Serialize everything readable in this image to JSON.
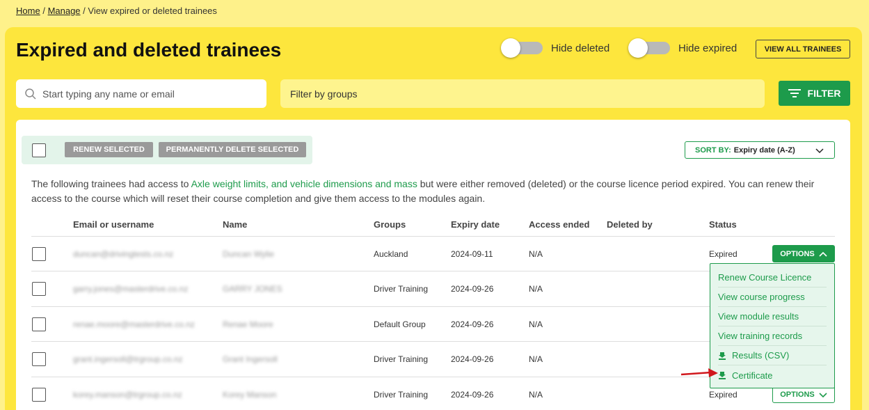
{
  "breadcrumb": {
    "home": "Home",
    "manage": "Manage",
    "sep": "/",
    "current": "View expired or deleted trainees"
  },
  "page_title": "Expired and deleted trainees",
  "toggles": {
    "hide_deleted": "Hide deleted",
    "hide_expired": "Hide expired"
  },
  "view_all_label": "VIEW ALL TRAINEES",
  "search": {
    "placeholder": "Start typing any name or email"
  },
  "groups_filter": {
    "placeholder": "Filter by groups"
  },
  "filter_label": "FILTER",
  "bulk": {
    "renew_label": "RENEW SELECTED",
    "delete_label": "PERMANENTLY DELETE SELECTED"
  },
  "sort": {
    "label": "SORT BY:",
    "value": "Expiry date (A-Z)"
  },
  "intro": {
    "before": "The following trainees had access to ",
    "course_link": "Axle weight limits, and vehicle dimensions and mass",
    "after": " but were either removed (deleted) or the course licence period expired. You can renew their access to the course which will reset their course completion and give them access to the modules again."
  },
  "table": {
    "headers": [
      "Email or username",
      "Name",
      "Groups",
      "Expiry date",
      "Access ended",
      "Deleted by",
      "Status"
    ],
    "rows": [
      {
        "email": "duncan@drivingtests.co.nz",
        "name": "Duncan Wylie",
        "group": "Auckland",
        "expiry": "2024-09-11",
        "access_ended": "N/A",
        "deleted_by": "",
        "status": "Expired"
      },
      {
        "email": "garry.jones@masterdrive.co.nz",
        "name": "GARRY JONES",
        "group": "Driver Training",
        "expiry": "2024-09-26",
        "access_ended": "N/A",
        "deleted_by": "",
        "status": ""
      },
      {
        "email": "renae.moore@masterdrive.co.nz",
        "name": "Renae Moore",
        "group": "Default Group",
        "expiry": "2024-09-26",
        "access_ended": "N/A",
        "deleted_by": "",
        "status": ""
      },
      {
        "email": "grant.ingersoll@trgroup.co.nz",
        "name": "Grant Ingersoll",
        "group": "Driver Training",
        "expiry": "2024-09-26",
        "access_ended": "N/A",
        "deleted_by": "",
        "status": ""
      },
      {
        "email": "korey.manson@trgroup.co.nz",
        "name": "Korey Manson",
        "group": "Driver Training",
        "expiry": "2024-09-26",
        "access_ended": "N/A",
        "deleted_by": "",
        "status": "Expired"
      }
    ]
  },
  "options_label": "OPTIONS",
  "options_menu": [
    "Renew Course Licence",
    "View course progress",
    "View module results",
    "View training records",
    "Results (CSV)",
    "Certificate"
  ],
  "colors": {
    "page_bg": "#fef18a",
    "panel_bg": "#fde63d",
    "accent_green": "#1d9b4b",
    "annotation_arrow": "#d0171c"
  }
}
